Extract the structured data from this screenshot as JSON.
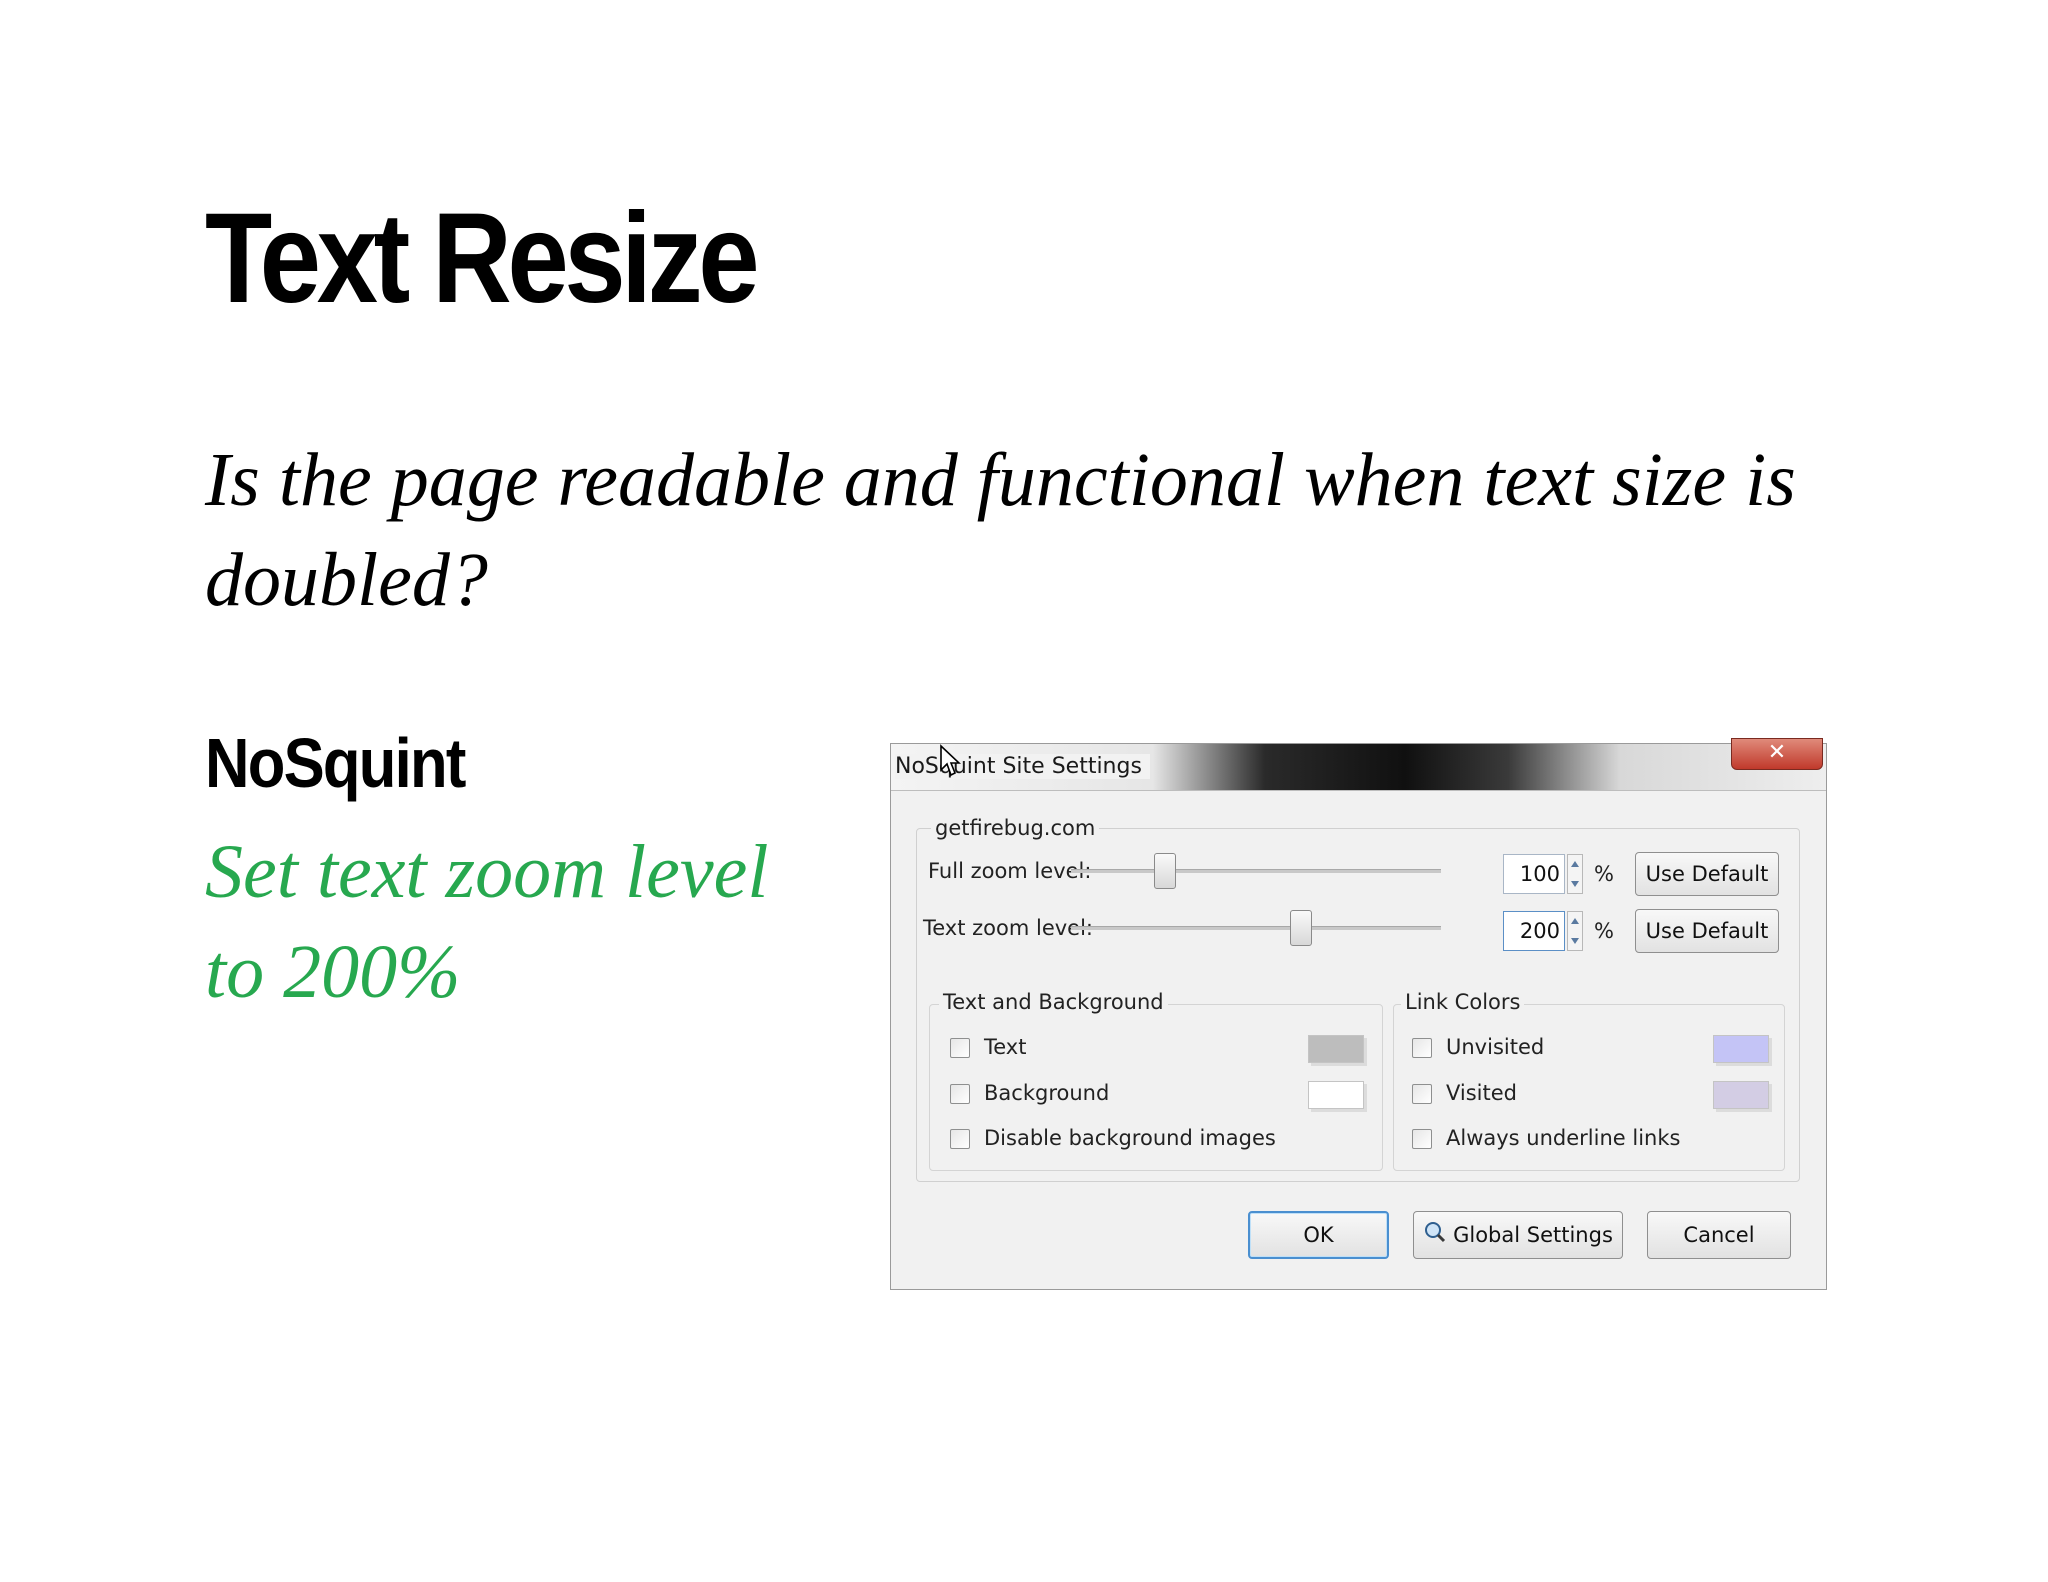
{
  "slide": {
    "title": "Text Resize",
    "question": "Is the page readable and functional when text size is doubled?",
    "tool_name": "NoSquint",
    "tool_description": "Set text zoom level to 200%"
  },
  "dialog": {
    "title": "NoSquint Site Settings",
    "close_glyph": "✕",
    "site": "getfirebug.com",
    "full_zoom": {
      "label": "Full zoom level:",
      "value": "100",
      "unit": "%",
      "button": "Use Default",
      "level": 0.25
    },
    "text_zoom": {
      "label": "Text zoom level:",
      "value": "200",
      "unit": "%",
      "button": "Use Default",
      "level": 0.62
    },
    "text_background": {
      "title": "Text and Background",
      "items": [
        {
          "label": "Text",
          "color": "#bdbdbd"
        },
        {
          "label": "Background",
          "color": "#ffffff"
        },
        {
          "label": "Disable background images"
        }
      ]
    },
    "link_colors": {
      "title": "Link Colors",
      "items": [
        {
          "label": "Unvisited",
          "color": "#c4c4f6"
        },
        {
          "label": "Visited",
          "color": "#d3cde4"
        },
        {
          "label": "Always underline links"
        }
      ]
    },
    "buttons": {
      "ok": "OK",
      "global": "Global Settings",
      "cancel": "Cancel"
    }
  },
  "colors": {
    "accent_green": "#27a84f",
    "focus_blue": "#4a8fd0"
  }
}
